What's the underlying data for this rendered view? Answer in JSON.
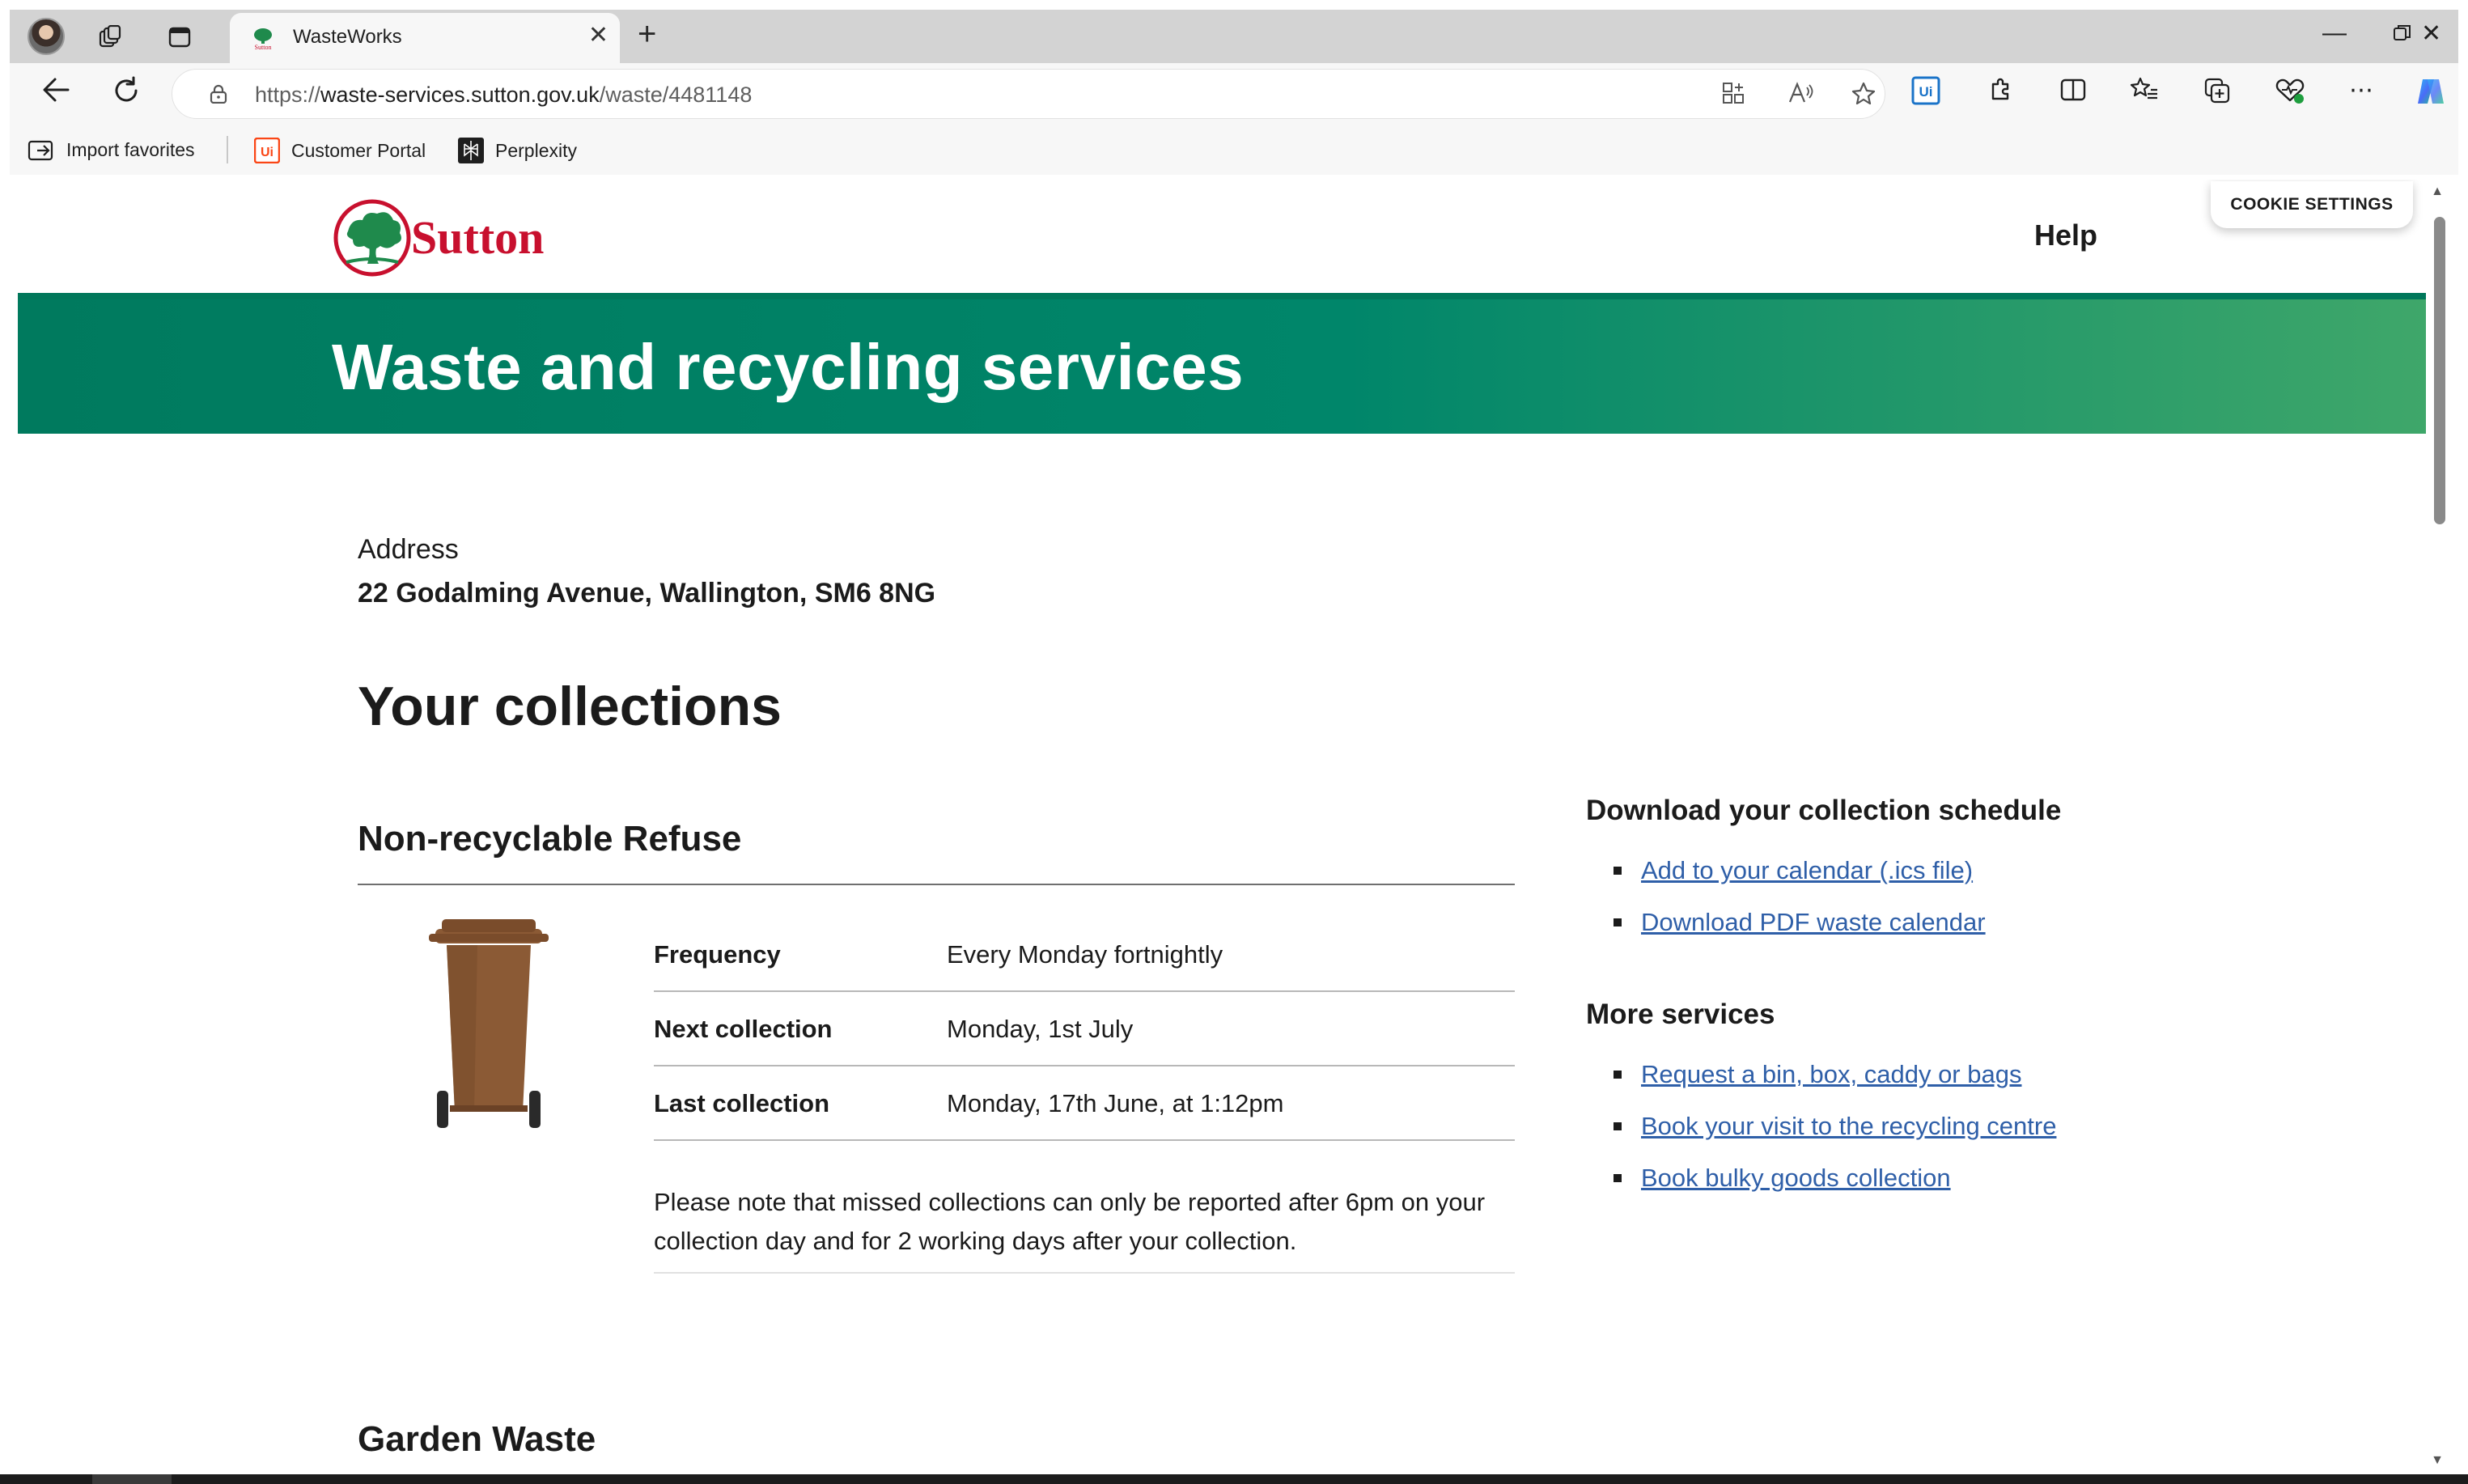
{
  "browser": {
    "tab": {
      "title": "WasteWorks"
    },
    "url": {
      "prefix": "https://",
      "host": "waste-services.sutton.gov.uk",
      "path": "/waste/4481148"
    },
    "favorites": [
      {
        "label": "Import favorites",
        "icon": "import-favorites-icon"
      },
      {
        "label": "Customer Portal",
        "icon": "uipath-icon"
      },
      {
        "label": "Perplexity",
        "icon": "perplexity-icon"
      }
    ],
    "extension_badge": "Ui"
  },
  "site": {
    "logo_text": "Sutton",
    "help_label": "Help",
    "cookie_label": "COOKIE SETTINGS",
    "hero_title": "Waste and recycling services",
    "brand_colors": {
      "green": "#00866a",
      "red": "#c8102e",
      "link": "#2f5fa8"
    }
  },
  "address": {
    "label": "Address",
    "value": "22 Godalming Avenue, Wallington, SM6 8NG"
  },
  "collections": {
    "heading": "Your collections",
    "services": [
      {
        "name": "Non-recyclable Refuse",
        "bin_color": "#8b5a35",
        "rows": [
          {
            "key": "Frequency",
            "value": "Every Monday fortnightly"
          },
          {
            "key": "Next collection",
            "value": "Monday, 1st July"
          },
          {
            "key": "Last collection",
            "value": "Monday, 17th June, at 1:12pm"
          }
        ],
        "note": "Please note that missed collections can only be reported after 6pm on your collection day and for 2 working days after your collection."
      },
      {
        "name": "Garden Waste"
      }
    ]
  },
  "sidebar": {
    "download": {
      "heading": "Download your collection schedule",
      "links": [
        "Add to your calendar (.ics file)",
        "Download PDF waste calendar"
      ]
    },
    "more": {
      "heading": "More services",
      "links": [
        "Request a bin, box, caddy or bags",
        "Book your visit to the recycling centre",
        "Book bulky goods collection"
      ]
    }
  }
}
